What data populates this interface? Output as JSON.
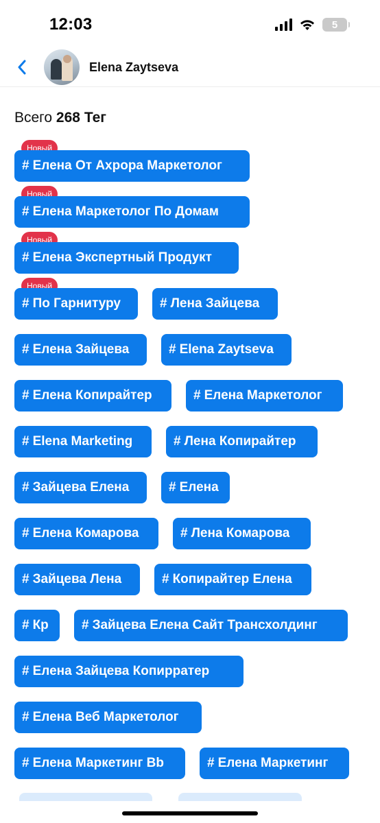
{
  "status_bar": {
    "time": "12:03",
    "battery_level": "5",
    "icons": [
      "signal-icon",
      "wifi-icon",
      "battery-icon"
    ]
  },
  "header": {
    "back_icon": "chevron-left-icon",
    "contact_name": "Elena Zaytseva"
  },
  "summary": {
    "prefix": "Всего",
    "count": "268",
    "unit": "Тег"
  },
  "colors": {
    "tag_background": "#0d7bea",
    "new_badge": "#e2334a",
    "accent": "#0d7bea"
  },
  "tag_hash": "#",
  "new_badge_label": "Новый",
  "tags": [
    {
      "label": "Елена От Ахрора Маркетолог",
      "is_new": true
    },
    {
      "label": "Елена Маркетолог По Домам",
      "is_new": true
    },
    {
      "label": "Елена Экспертный Продукт",
      "is_new": true
    },
    {
      "label": "По Гарнитуру",
      "is_new": true
    },
    {
      "label": "Лена Зайцева",
      "is_new": false
    },
    {
      "label": "Елена Зайцева",
      "is_new": false
    },
    {
      "label": "Elena Zaytseva",
      "is_new": false
    },
    {
      "label": "Елена Копирайтер",
      "is_new": false
    },
    {
      "label": "Елена Маркетолог",
      "is_new": false
    },
    {
      "label": "Elena Marketing",
      "is_new": false
    },
    {
      "label": "Лена Копирайтер",
      "is_new": false
    },
    {
      "label": "Зайцева Елена",
      "is_new": false
    },
    {
      "label": "Елена",
      "is_new": false
    },
    {
      "label": "Елена Комарова",
      "is_new": false
    },
    {
      "label": "Лена Комарова",
      "is_new": false
    },
    {
      "label": "Зайцева Лена",
      "is_new": false
    },
    {
      "label": "Копирайтер Елена",
      "is_new": false
    },
    {
      "label": "Кр",
      "is_new": false
    },
    {
      "label": "Зайцева Елена Сайт Трансхолдинг",
      "is_new": false
    },
    {
      "label": "Елена Зайцева Копирратер",
      "is_new": false
    },
    {
      "label": "Елена Веб Маркетолог",
      "is_new": false
    },
    {
      "label": "Елена Маркетинг Bb",
      "is_new": false
    },
    {
      "label": "Елена Маркетинг",
      "is_new": false
    }
  ]
}
